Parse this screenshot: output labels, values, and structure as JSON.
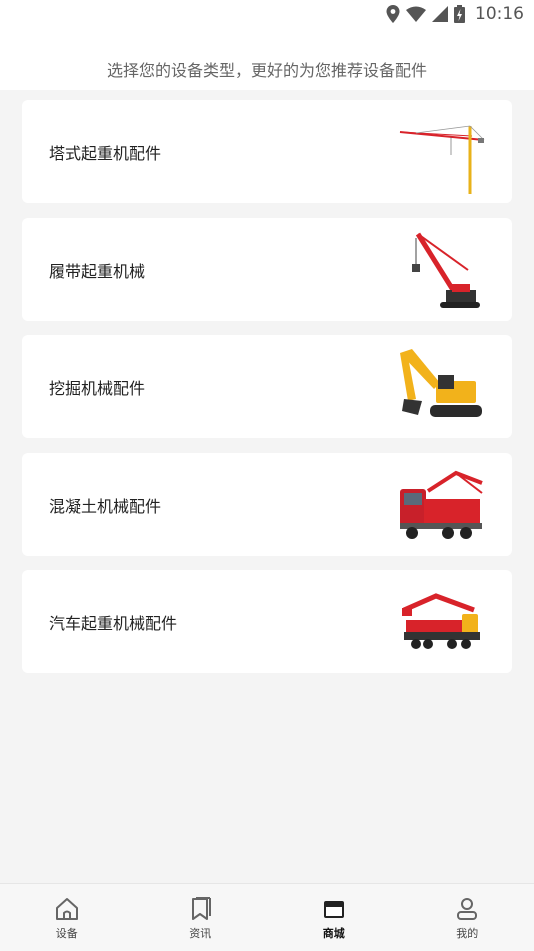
{
  "status_bar": {
    "time": "10:16",
    "icons": [
      "location-icon",
      "wifi-icon",
      "signal-icon",
      "battery-icon"
    ]
  },
  "header": {
    "title": "选择您的设备类型，更好的为您推荐设备配件"
  },
  "categories": [
    {
      "label": "塔式起重机配件",
      "icon": "tower-crane-image"
    },
    {
      "label": "履带起重机械",
      "icon": "crawler-crane-image"
    },
    {
      "label": "挖掘机械配件",
      "icon": "excavator-image"
    },
    {
      "label": "混凝土机械配件",
      "icon": "concrete-pump-truck-image"
    },
    {
      "label": "汽车起重机械配件",
      "icon": "truck-crane-image"
    }
  ],
  "tabbar": {
    "items": [
      {
        "label": "设备",
        "icon": "home-icon",
        "active": false
      },
      {
        "label": "资讯",
        "icon": "bookmark-icon",
        "active": false
      },
      {
        "label": "商城",
        "icon": "store-icon",
        "active": true
      },
      {
        "label": "我的",
        "icon": "user-icon",
        "active": false
      }
    ]
  },
  "colors": {
    "background": "#f4f4f4",
    "card": "#ffffff",
    "crane_red": "#d8232a",
    "machine_yellow": "#f2b21b"
  }
}
